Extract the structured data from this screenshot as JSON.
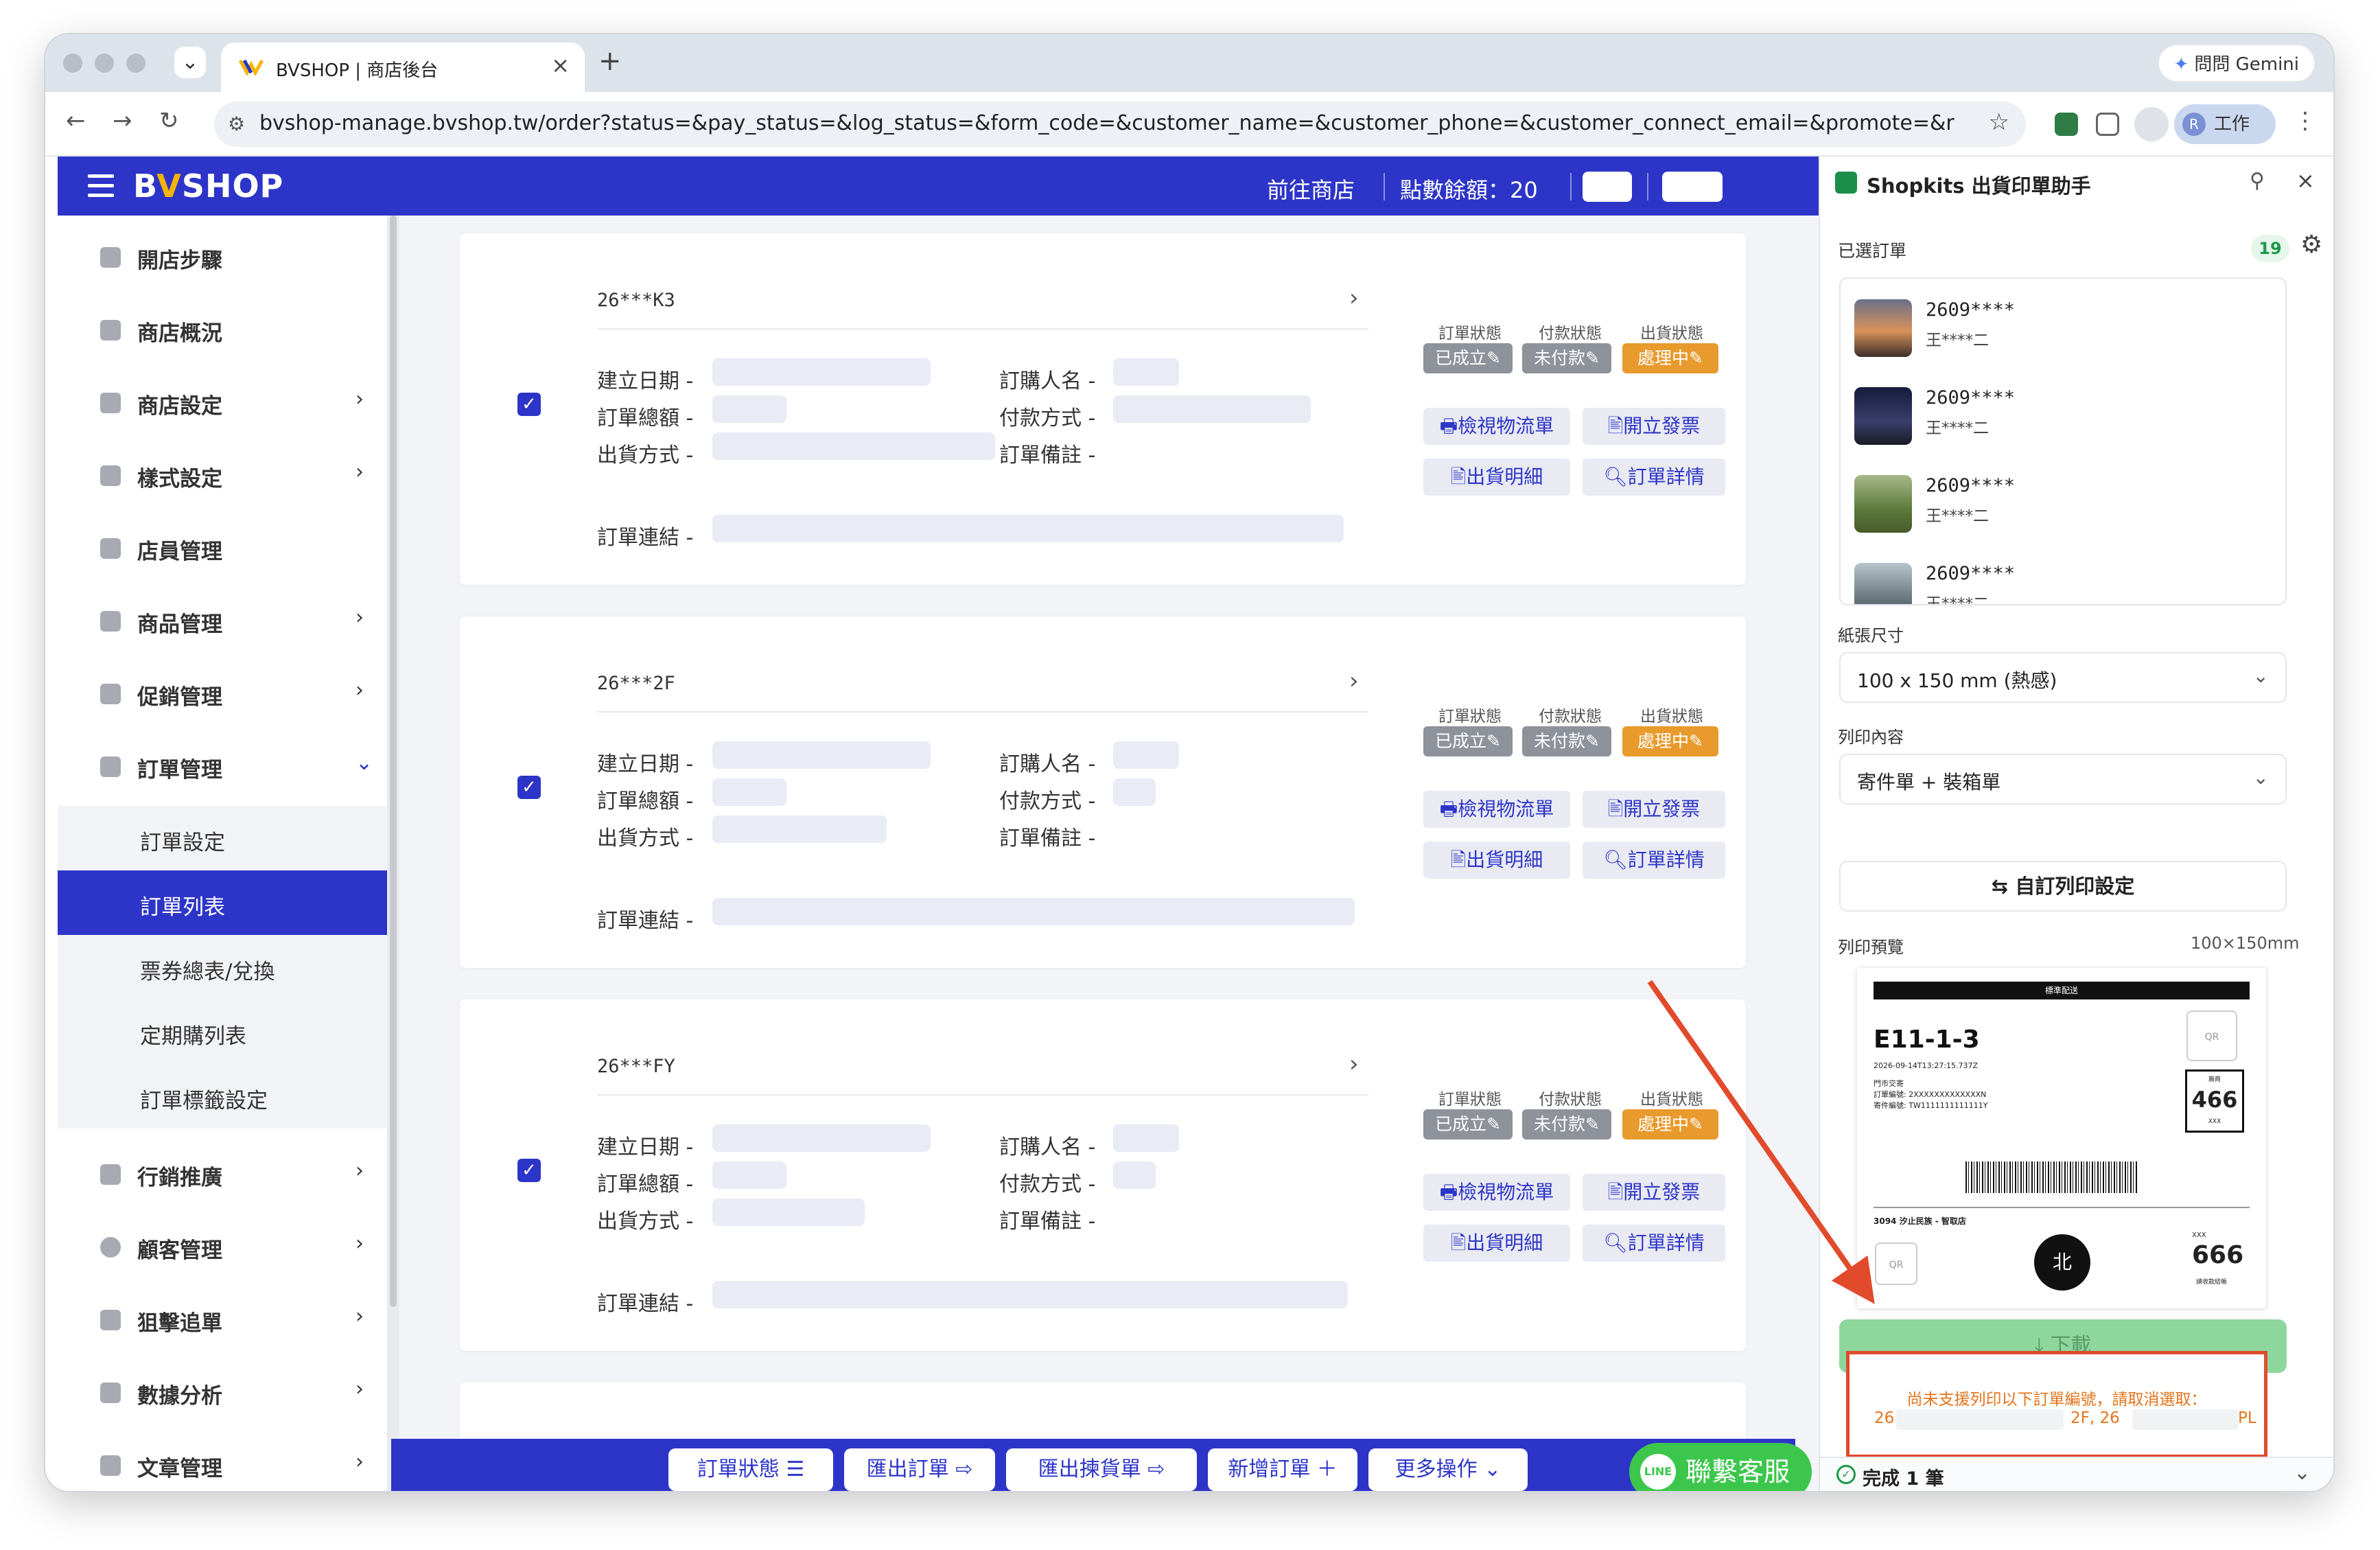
{
  "browser": {
    "tab_title": "BVSHOP | 商店後台",
    "tab_close": "×",
    "new_tab": "+",
    "gemini": "問問 Gemini",
    "url": "bvshop-manage.bvshop.tw/order?status=&pay_status=&log_status=&form_code=&customer_name=&customer_phone=&customer_connect_email=&promote=&receiver_name=&r...",
    "profile_initial": "R",
    "profile_label": "工作"
  },
  "header": {
    "logo_pre": "B",
    "logo_v": "V",
    "logo_post": "SHOP",
    "store_link": "前往商店",
    "points": "點數餘額：20"
  },
  "sidebar": {
    "items": [
      {
        "label": "開店步驟"
      },
      {
        "label": "商店概況"
      },
      {
        "label": "商店設定"
      },
      {
        "label": "樣式設定"
      },
      {
        "label": "店員管理"
      },
      {
        "label": "商品管理"
      },
      {
        "label": "促銷管理"
      },
      {
        "label": "訂單管理"
      },
      {
        "label": "行銷推廣"
      },
      {
        "label": "顧客管理"
      },
      {
        "label": "狙擊追單"
      },
      {
        "label": "數據分析"
      },
      {
        "label": "文章管理"
      }
    ],
    "sub_items": [
      {
        "label": "訂單設定"
      },
      {
        "label": "訂單列表"
      },
      {
        "label": "票券總表/兌換"
      },
      {
        "label": "定期購列表"
      },
      {
        "label": "訂單標籤設定"
      }
    ]
  },
  "order_labels": {
    "created": "建立日期 -",
    "total": "訂單總額 -",
    "shipping": "出貨方式 -",
    "buyer": "訂購人名 -",
    "payment": "付款方式 -",
    "note": "訂單備註 -",
    "link": "訂單連結 -",
    "status_order": "訂單狀態",
    "status_pay": "付款狀態",
    "status_ship": "出貨狀態",
    "btn_track": "🖶檢視物流單",
    "btn_invoice": "🖹開立發票",
    "btn_detail": "🖹出貨明細",
    "btn_view": "🔍︎訂單詳情"
  },
  "orders": [
    {
      "no": "26***K3",
      "order_status": "已成立✎",
      "pay_status": "未付款✎",
      "ship_status": "處理中✎",
      "checked": "✓"
    },
    {
      "no": "26***2F",
      "order_status": "已成立✎",
      "pay_status": "未付款✎",
      "ship_status": "處理中✎",
      "checked": "✓"
    },
    {
      "no": "26***FY",
      "order_status": "已成立✎",
      "pay_status": "未付款✎",
      "ship_status": "處理中✎",
      "checked": "✓"
    }
  ],
  "bottom_bar": {
    "b1": "訂單狀態 ☰",
    "b2": "匯出訂單 ⇨",
    "b3": "匯出揀貨單 ⇨",
    "b4": "新增訂單 ＋",
    "b5": "更多操作 ⌄",
    "line_logo": "LINE",
    "line": "聯繫客服"
  },
  "panel": {
    "title": "Shopkits 出貨印單助手",
    "selected_label": "已選訂單",
    "selected_count": "19",
    "list": [
      {
        "no": "2609****",
        "customer": "王****二"
      },
      {
        "no": "2609****",
        "customer": "王****二"
      },
      {
        "no": "2609****",
        "customer": "王****二"
      },
      {
        "no": "2609****",
        "customer": "王****二"
      }
    ],
    "paper_label": "紙張尺寸",
    "paper_value": "100 x 150 mm (熱感)",
    "content_label": "列印內容",
    "content_value": "寄件單 + 裝箱單",
    "custom_button": "⇆  自訂列印設定",
    "preview_label": "列印預覽",
    "preview_size": "100×150mm",
    "download": "⤓  下載",
    "warning_line1": "尚未支援列印以下訂單編號，請取消選取：",
    "warning_line2_a": "26",
    "warning_line2_b": "2F, 26",
    "warning_line2_c": "PL",
    "done": "完成 1 筆"
  },
  "label_preview": {
    "bar": "標準配送",
    "code": "E11-1-3",
    "timestamp": "2026-09-14T13:27:15.737Z",
    "line1": "門市交寄",
    "line2": "訂單編號: 2XXXXXXXXXXXXXN",
    "line3": "寄件編號: TW1111111111111Y",
    "qr": "QR",
    "box_top": "廠商",
    "box_num": "466",
    "box_bottom": "XXX",
    "store": "3094 汐止民族 - 智取店",
    "circle": "北",
    "xxx": "XXX",
    "num2": "666",
    "recv": "請收款結帳"
  },
  "colors": {
    "brand": "#2d35c8",
    "status_gray": "#8e929a",
    "status_orange": "#e89a2c",
    "warning_border": "#e24a2c",
    "download_green": "#8ed79c",
    "line_green": "#3cc74c"
  }
}
